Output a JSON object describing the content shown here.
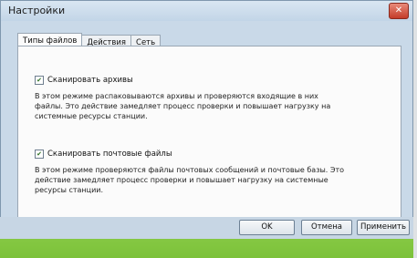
{
  "window": {
    "title": "Настройки",
    "close_glyph": "✕"
  },
  "tabs": [
    {
      "label": "Типы файлов",
      "active": true
    },
    {
      "label": "Действия",
      "active": false
    },
    {
      "label": "Сеть",
      "active": false
    }
  ],
  "options": [
    {
      "label": "Сканировать архивы",
      "checked": true,
      "description": "В этом режиме распаковываются архивы и проверяются входящие в них файлы. Это действие замедляет процесс проверки и повышает нагрузку на системные ресурсы станции."
    },
    {
      "label": "Сканировать почтовые файлы",
      "checked": true,
      "description": "В этом режиме проверяются файлы почтовых сообщений и почтовые базы. Это действие замедляет процесс проверки и повышает нагрузку на системные ресурсы станции."
    }
  ],
  "buttons": {
    "ok": "OK",
    "cancel": "Отмена",
    "apply": "Применить"
  }
}
